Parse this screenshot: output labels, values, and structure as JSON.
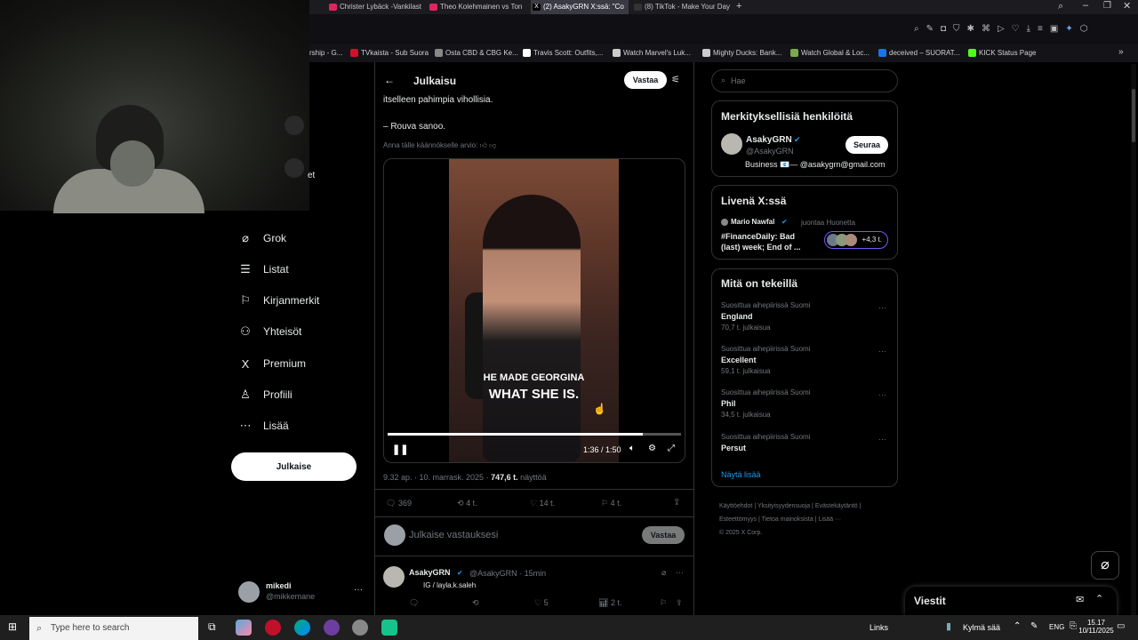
{
  "browser": {
    "tabs": [
      {
        "label": "Christer Lybäck -Vankilast",
        "color": "#e0245e"
      },
      {
        "label": "Theo Kolehmainen vs Ton",
        "color": "#e0245e"
      },
      {
        "label": "(2) AsakyGRN X:ssä: \"Co",
        "color": "#555555"
      },
      {
        "label": "(8) TikTok - Make Your Day",
        "color": "#555555"
      }
    ],
    "new_tab": "+",
    "bookmarks": [
      {
        "label": "rship - G...",
        "color": "#666666"
      },
      {
        "label": "TVkaista - Sub Suora",
        "color": "#d1102b"
      },
      {
        "label": "Osta CBD & CBG Ke...",
        "color": "#888888"
      },
      {
        "label": "Travis Scott: Outfits,...",
        "color": "#ffffff"
      },
      {
        "label": "Watch Marvel's Luk...",
        "color": "#cccccc"
      },
      {
        "label": "Mighty Ducks: Bank...",
        "color": "#cccccc"
      },
      {
        "label": "Watch Global & Loc...",
        "color": "#7aa84a"
      },
      {
        "label": "deceived – SUORAT...",
        "color": "#1a73e8"
      },
      {
        "label": "KICK Status Page",
        "color": "#53fc18"
      }
    ]
  },
  "webcam_partial_text": "et",
  "nav": {
    "items": [
      {
        "label": "Grok",
        "icon": "grok-icon",
        "glyph": "⌀"
      },
      {
        "label": "Listat",
        "icon": "list-icon",
        "glyph": "☰"
      },
      {
        "label": "Kirjanmerkit",
        "icon": "bookmark-icon",
        "glyph": "⚐"
      },
      {
        "label": "Yhteisöt",
        "icon": "communities-icon",
        "glyph": "⚇"
      },
      {
        "label": "Premium",
        "icon": "x-logo-icon",
        "glyph": "X"
      },
      {
        "label": "Profiili",
        "icon": "profile-icon",
        "glyph": "♙"
      },
      {
        "label": "Lisää",
        "icon": "more-icon",
        "glyph": "⋯"
      }
    ],
    "post_button": "Julkaise",
    "account": {
      "name": "mikedi",
      "handle": "@mikkemane",
      "more": "···"
    }
  },
  "post": {
    "header_title": "Julkaisu",
    "reply_button": "Vastaa",
    "text_line1": "itselleen pahimpia vihollisia.",
    "text_line2": "– Rouva sanoo.",
    "rate_translation": "Anna tälle käännökselle arvio:",
    "video": {
      "caption_line1": "HE MADE GEORGINA",
      "caption_line2": "WHAT SHE IS.",
      "time": "1:36 / 1:50",
      "progress": 0.87
    },
    "timestamp": "9.32 ap. · 10. marrask. 2025 · ",
    "views_count": "747,6 t.",
    "views_label": "näyttöä",
    "stats": {
      "replies": "369",
      "reposts": "4 t.",
      "likes": "14 t.",
      "bookmarks": "4 t."
    },
    "reply_placeholder": "Julkaise vastauksesi",
    "reply_submit": "Vastaa"
  },
  "reply_tweet": {
    "name": "AsakyGRN",
    "handle": "@AsakyGRN · 15min",
    "text": "IG / layla.k.saleh",
    "stats": {
      "replies": "",
      "likes": "5",
      "views": "2 t."
    }
  },
  "search": {
    "placeholder": "Hae"
  },
  "relevant": {
    "title": "Merkityksellisiä henkilöitä",
    "name": "AsakyGRN",
    "handle": "@AsakyGRN",
    "bio": "Business 📧— @asakygrn@gmail.com",
    "follow": "Seuraa"
  },
  "live": {
    "title": "Livenä X:ssä",
    "host": "Mario Nawfal",
    "host_suffix": "juontaa Huonetta",
    "topic_line1": "#FinanceDaily: Bad",
    "topic_line2": "(last) week; End of ...",
    "listeners": "+4,3 t."
  },
  "trends": {
    "title": "Mitä on tekeillä",
    "items": [
      {
        "context": "Suosittua aihepiirissä Suomi",
        "name": "England",
        "count": "70,7 t. julkaisua"
      },
      {
        "context": "Suosittua aihepiirissä Suomi",
        "name": "Excellent",
        "count": "59,1 t. julkaisua"
      },
      {
        "context": "Suosittua aihepiirissä Suomi",
        "name": "Phil",
        "count": "34,5 t. julkaisua"
      },
      {
        "context": "Suosittua aihepiirissä Suomi",
        "name": "Persut",
        "count": ""
      }
    ],
    "show_more": "Näytä lisää"
  },
  "footer": {
    "line1": [
      "Käyttöehdot",
      "Yksityisyydensuoja",
      "Evästekäytäntö"
    ],
    "line2": [
      "Esteettömyys",
      "Tietoa mainoksista",
      "Lisää ···"
    ],
    "copyright": "© 2025 X Corp."
  },
  "messages": {
    "title": "Viestit"
  },
  "taskbar": {
    "search_placeholder": "Type here to search",
    "links": "Links",
    "weather": "Kylmä sää",
    "lang": "ENG",
    "time": "15.17",
    "date": "10/11/2025"
  }
}
